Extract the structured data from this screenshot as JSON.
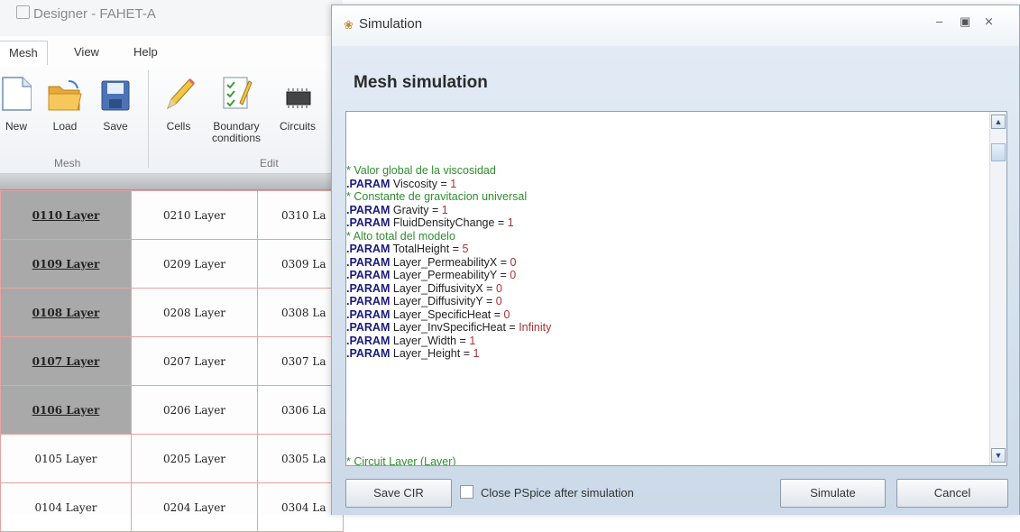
{
  "designer": {
    "title": "Designer - FAHET-A",
    "menu_tabs": [
      "Mesh",
      "View",
      "Help"
    ],
    "ribbon": {
      "buttons": [
        "New",
        "Load",
        "Save",
        "Cells",
        "Boundary conditions",
        "Circuits"
      ],
      "groups": [
        "Mesh",
        "Edit"
      ]
    },
    "grid": {
      "rows": [
        [
          "0110 Layer",
          "0210 Layer",
          "0310 La"
        ],
        [
          "0109 Layer",
          "0209 Layer",
          "0309 La"
        ],
        [
          "0108 Layer",
          "0208 Layer",
          "0308 La"
        ],
        [
          "0107 Layer",
          "0207 Layer",
          "0307 La"
        ],
        [
          "0106 Layer",
          "0206 Layer",
          "0306 La"
        ],
        [
          "0105 Layer",
          "0205 Layer",
          "0305 La"
        ],
        [
          "0104 Layer",
          "0204 Layer",
          "0304 La"
        ]
      ],
      "selected_first_col_rows": 5
    }
  },
  "dialog": {
    "title": "Simulation",
    "heading": "Mesh simulation",
    "code_lines": [
      {
        "type": "comment",
        "text": "* Valor global de la viscosidad"
      },
      {
        "type": "param",
        "name": "Viscosity",
        "value": "1"
      },
      {
        "type": "comment",
        "text": "* Constante de gravitacion universal"
      },
      {
        "type": "param",
        "name": "Gravity",
        "value": "1"
      },
      {
        "type": "param",
        "name": "FluidDensityChange",
        "value": "1"
      },
      {
        "type": "comment",
        "text": "* Alto total del modelo"
      },
      {
        "type": "param",
        "name": "TotalHeight",
        "value": "5"
      },
      {
        "type": "param",
        "name": "Layer_PermeabilityX",
        "value": "0"
      },
      {
        "type": "param",
        "name": "Layer_PermeabilityY",
        "value": "0"
      },
      {
        "type": "param",
        "name": "Layer_DiffusivityX",
        "value": "0"
      },
      {
        "type": "param",
        "name": "Layer_DiffusivityY",
        "value": "0"
      },
      {
        "type": "param",
        "name": "Layer_SpecificHeat",
        "value": "0"
      },
      {
        "type": "param",
        "name": "Layer_InvSpecificHeat",
        "value": "Infinity"
      },
      {
        "type": "param",
        "name": "Layer_Width",
        "value": "1"
      },
      {
        "type": "param",
        "name": "Layer_Height",
        "value": "1"
      }
    ],
    "param_keyword": ".PARAM",
    "trailing_line": "* Circuit Layer (Layer)",
    "save_button": "Save CIR",
    "checkbox_label": "Close PSpice after simulation",
    "checkbox_checked": false,
    "simulate_button": "Simulate",
    "cancel_button": "Cancel"
  },
  "icons": [
    "minimize-icon",
    "maximize-icon",
    "close-icon",
    "scroll-up-icon",
    "scroll-down-icon"
  ],
  "colors": {
    "comment": "#2f8d2f",
    "keyword": "#1a1a80",
    "number": "#a83232",
    "selected_cell": "#a9a9a9",
    "grid_border": "#e7a2a2"
  }
}
